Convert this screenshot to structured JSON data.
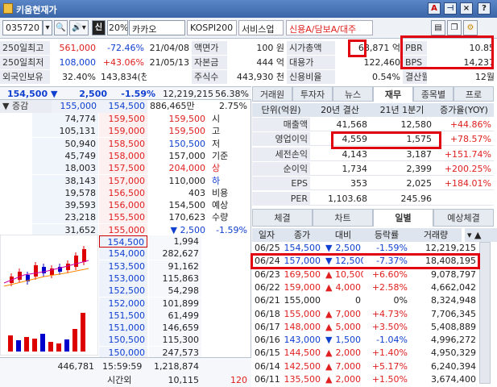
{
  "window": {
    "title": "키움현재가",
    "btn_a": "A",
    "btn_x": "×",
    "btn_q": "?"
  },
  "toolbar": {
    "code": "035720",
    "market": "신",
    "pct": "20%",
    "name": "카카오",
    "index": "KOSPI200",
    "sector": "서비스업",
    "credit": "신용A/담보A/대주"
  },
  "info": [
    [
      {
        "t": "250일최고",
        "k": "lbl"
      },
      {
        "t": "561,000",
        "k": "red"
      },
      {
        "t": "-72.46%",
        "k": "blue"
      },
      {
        "t": "21/04/08"
      },
      {
        "t": "액면가",
        "k": "lbl"
      },
      {
        "t": "100 원"
      },
      {
        "t": "시가총액",
        "k": "lbl"
      },
      {
        "t": "68,871 억"
      },
      {
        "t": "PBR",
        "k": "lbl"
      },
      {
        "t": "10.85"
      }
    ],
    [
      {
        "t": "250일최저",
        "k": "lbl"
      },
      {
        "t": "108,000",
        "k": "blue"
      },
      {
        "t": "+43.06%",
        "k": "red"
      },
      {
        "t": "21/05/13"
      },
      {
        "t": "자본금",
        "k": "lbl"
      },
      {
        "t": "444 억"
      },
      {
        "t": "대용가",
        "k": "lbl"
      },
      {
        "t": "122,460"
      },
      {
        "t": "BPS",
        "k": "lbl"
      },
      {
        "t": "14,237"
      }
    ],
    [
      {
        "t": "외국인보유",
        "k": "lbl"
      },
      {
        "t": "32.40%"
      },
      {
        "t": "143,834(천)"
      },
      {
        "t": ""
      },
      {
        "t": "주식수",
        "k": "lbl"
      },
      {
        "t": "443,930 천"
      },
      {
        "t": "신용비율",
        "k": "lbl"
      },
      {
        "t": "0.54%"
      },
      {
        "t": "결산월",
        "k": "lbl"
      },
      {
        "t": "12월"
      }
    ]
  ],
  "price": {
    "cur": "154,500",
    "chg": "2,500",
    "pct": "-1.59%",
    "vol": "12,219,215",
    "ratio": "56.38%",
    "vol_prev": "886,465만",
    "pct2": "2.75%"
  },
  "ob_head": {
    "label": "증감",
    "a": "155,000",
    "b": "154,500"
  },
  "asks": [
    [
      "74,774",
      "159,500",
      "159,500",
      "시"
    ],
    [
      "105,131",
      "159,000",
      "159,500",
      "고"
    ],
    [
      "50,940",
      "158,500",
      "150,500",
      "저"
    ],
    [
      "45,749",
      "158,000",
      "157,000",
      "기준"
    ],
    [
      "18,003",
      "157,500",
      "204,000",
      "상"
    ],
    [
      "38,143",
      "157,000",
      "110,000",
      "하"
    ],
    [
      "19,578",
      "156,500",
      "403",
      "비용"
    ],
    [
      "39,593",
      "156,000",
      "154,500",
      "예상"
    ],
    [
      "23,218",
      "155,500",
      "170,623",
      "수량"
    ],
    [
      "31,652",
      "155,000",
      "▼ 2,500",
      "-1.59%"
    ]
  ],
  "bids": [
    [
      "154,500",
      "1,994"
    ],
    [
      "154,000",
      "282,627"
    ],
    [
      "153,500",
      "91,162"
    ],
    [
      "153,000",
      "115,863"
    ],
    [
      "152,500",
      "54,298"
    ],
    [
      "152,000",
      "101,899"
    ],
    [
      "151,500",
      "61,499"
    ],
    [
      "151,000",
      "146,659"
    ],
    [
      "150,500",
      "115,300"
    ],
    [
      "150,000",
      "247,573"
    ]
  ],
  "ob_foot": {
    "a": "446,781",
    "time": "15:59:59",
    "b": "1,218,874",
    "after": "시간외",
    "c": "10,115",
    "d": "120"
  },
  "fin_tabs": [
    "거래원",
    "투자자",
    "뉴스",
    "재무",
    "종목별",
    "프로"
  ],
  "fin_head": [
    "단위(억원)",
    "20년 결산",
    "21년 1분기",
    "증가율(YOY)"
  ],
  "fin_rows": [
    [
      "매출액",
      "41,568",
      "12,580",
      "+44.86%"
    ],
    [
      "영업이익",
      "4,559",
      "1,575",
      "+78.57%"
    ],
    [
      "세전손익",
      "4,143",
      "3,187",
      "+151.74%"
    ],
    [
      "순이익",
      "1,734",
      "2,399",
      "+200.25%"
    ],
    [
      "EPS",
      "353",
      "2,025",
      "+184.01%"
    ],
    [
      "PER",
      "1,103.68",
      "245.96",
      ""
    ]
  ],
  "daily_tabs": [
    "체결",
    "차트",
    "일별",
    "예상체결"
  ],
  "daily_head": [
    "일자",
    "종가",
    "대비",
    "등락률",
    "거래량"
  ],
  "daily_rows": [
    [
      "06/25",
      "154,500",
      "▼",
      "2,500",
      "-1.59%",
      "12,219,215",
      "blue"
    ],
    [
      "06/24",
      "157,000",
      "▼",
      "12,500",
      "-7.37%",
      "18,408,195",
      "blue"
    ],
    [
      "06/23",
      "169,500",
      "▲",
      "10,500",
      "+6.60%",
      "9,078,797",
      "red"
    ],
    [
      "06/22",
      "159,000",
      "▲",
      "4,000",
      "+2.58%",
      "4,662,042",
      "red"
    ],
    [
      "06/21",
      "155,000",
      "",
      "0",
      "0%",
      "8,324,948",
      "bk"
    ],
    [
      "06/18",
      "155,000",
      "▲",
      "7,000",
      "+4.73%",
      "7,706,345",
      "red"
    ],
    [
      "06/17",
      "148,000",
      "▲",
      "5,000",
      "+3.50%",
      "5,408,889",
      "red"
    ],
    [
      "06/16",
      "143,000",
      "▼",
      "1,500",
      "-1.04%",
      "4,996,272",
      "blue"
    ],
    [
      "06/15",
      "144,500",
      "▲",
      "2,000",
      "+1.40%",
      "4,950,329",
      "red"
    ],
    [
      "06/14",
      "142,500",
      "▲",
      "7,000",
      "+5.17%",
      "6,240,394",
      "red"
    ],
    [
      "06/11",
      "135,500",
      "▲",
      "2,000",
      "+1.50%",
      "3,674,400",
      "red"
    ]
  ]
}
